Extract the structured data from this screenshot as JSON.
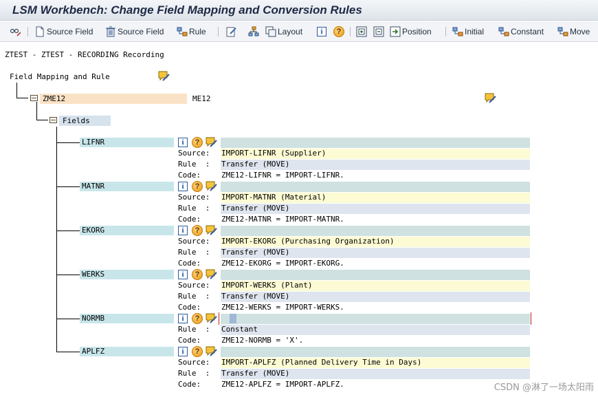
{
  "window": {
    "title": "LSM Workbench: Change Field Mapping and Conversion Rules"
  },
  "toolbar": {
    "source_field_1": "Source Field",
    "source_field_2": "Source Field",
    "rule": "Rule",
    "layout": "Layout",
    "position": "Position",
    "initial": "Initial",
    "constant": "Constant",
    "move": "Move"
  },
  "header": {
    "recording": "ZTEST - ZTEST - RECORDING Recording"
  },
  "tree": {
    "root_label": "Field Mapping and Rule",
    "structure": {
      "name": "ZME12",
      "desc": "ME12"
    },
    "fields_label": "Fields",
    "labels": {
      "source": "Source:",
      "rule": "Rule  :",
      "code": "Code:"
    },
    "fields": [
      {
        "name": "LIFNR",
        "source": "IMPORT-LIFNR (Supplier)",
        "rule": "Transfer (MOVE)",
        "code": "ZME12-LIFNR = IMPORT-LIFNR."
      },
      {
        "name": "MATNR",
        "source": "IMPORT-MATNR (Material)",
        "rule": "Transfer (MOVE)",
        "code": "ZME12-MATNR = IMPORT-MATNR."
      },
      {
        "name": "EKORG",
        "source": "IMPORT-EKORG (Purchasing Organization)",
        "rule": "Transfer (MOVE)",
        "code": "ZME12-EKORG = IMPORT-EKORG."
      },
      {
        "name": "WERKS",
        "source": "IMPORT-WERKS (Plant)",
        "rule": "Transfer (MOVE)",
        "code": "ZME12-WERKS = IMPORT-WERKS."
      },
      {
        "name": "NORMB",
        "source": "",
        "rule": "Constant",
        "code": "ZME12-NORMB = 'X'."
      },
      {
        "name": "APLFZ",
        "source": "IMPORT-APLFZ (Planned Delivery Time in Days)",
        "rule": "Transfer (MOVE)",
        "code": "ZME12-APLFZ = IMPORT-APLFZ."
      }
    ]
  },
  "watermark": "CSDN @淋了一场太阳雨"
}
